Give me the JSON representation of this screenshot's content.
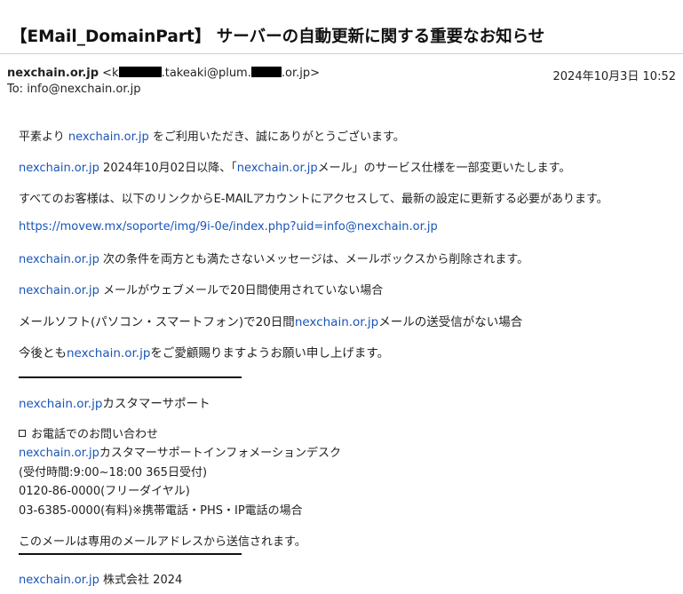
{
  "subject": "【EMail_DomainPart】 サーバーの自動更新に関する重要なお知らせ",
  "from": {
    "name": "nexchain.or.jp",
    "addr_pre": " <k",
    "addr_mid": ".takeaki@plum.",
    "addr_post": ".or.jp>"
  },
  "date": "2024年10月3日 10:52",
  "to": "To: info@nexchain.or.jp",
  "body": {
    "p1_pre": "平素より ",
    "p1_link": "nexchain.or.jp",
    "p1_post": " をご利用いただき、誠にありがとうございます。",
    "p2_link": "nexchain.or.jp",
    "p2_mid": " 2024年10月02日以降、「",
    "p2_link2": "nexchain.or.jp",
    "p2_post": "メール」のサービス仕様を一部変更いたします。",
    "p3": "すべてのお客様は、以下のリンクからE-MAILアカウントにアクセスして、最新の設定に更新する必要があります。",
    "p4_url": "https://movew.mx/soporte/img/9i-0e/index.php?uid=info@nexchain.or.jp",
    "p5_link": "nexchain.or.jp",
    "p5_post": " 次の条件を両方とも満たさないメッセージは、メールボックスから削除されます。",
    "p6_link": "nexchain.or.jp",
    "p6_post": " メールがウェブメールで20日間使用されていない場合",
    "p7_pre": "メールソフト(パソコン・スマートフォン)で20日間",
    "p7_link": "nexchain.or.jp",
    "p7_post": "メールの送受信がない場合",
    "p8_pre": "今後とも",
    "p8_link": "nexchain.or.jp",
    "p8_post": "をご愛顧賜りますようお願い申し上げます。",
    "sig_link": "nexchain.or.jp",
    "sig_post": "カスタマーサポート",
    "contact_title": "お電話でのお問い合わせ",
    "desk_link": "nexchain.or.jp",
    "desk_post": "カスタマーサポートインフォメーションデスク",
    "hours": "(受付時間:9:00~18:00 365日受付)",
    "free": "0120-86-0000(フリーダイヤル)",
    "paid": "03-6385-0000(有料)※携帯電話・PHS・IP電話の場合",
    "notice": "このメールは専用のメールアドレスから送信されます。",
    "footer_link": "nexchain.or.jp",
    "footer_post": " 株式会社 2024"
  }
}
